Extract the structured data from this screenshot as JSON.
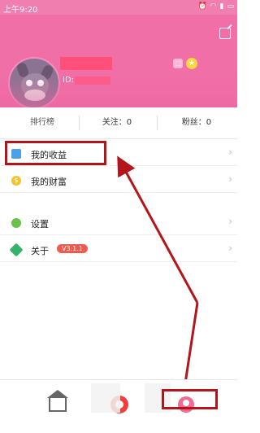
{
  "status_bar": {
    "time": "上午9:20",
    "icons": [
      "alarm-off-icon",
      "wifi-icon",
      "signal-icon",
      "battery-icon"
    ]
  },
  "profile": {
    "id_label": "ID:"
  },
  "stats": {
    "rank": "排行榜",
    "follow": "关注：0",
    "fans": "粉丝：0"
  },
  "menu": {
    "earnings": "我的收益",
    "wealth": "我的财富",
    "settings": "设置",
    "about": "关于",
    "version": "V3.1.1"
  },
  "colors": {
    "header": "#f06fa7",
    "highlight": "#b3151b",
    "accent_red": "#f03e3e"
  }
}
